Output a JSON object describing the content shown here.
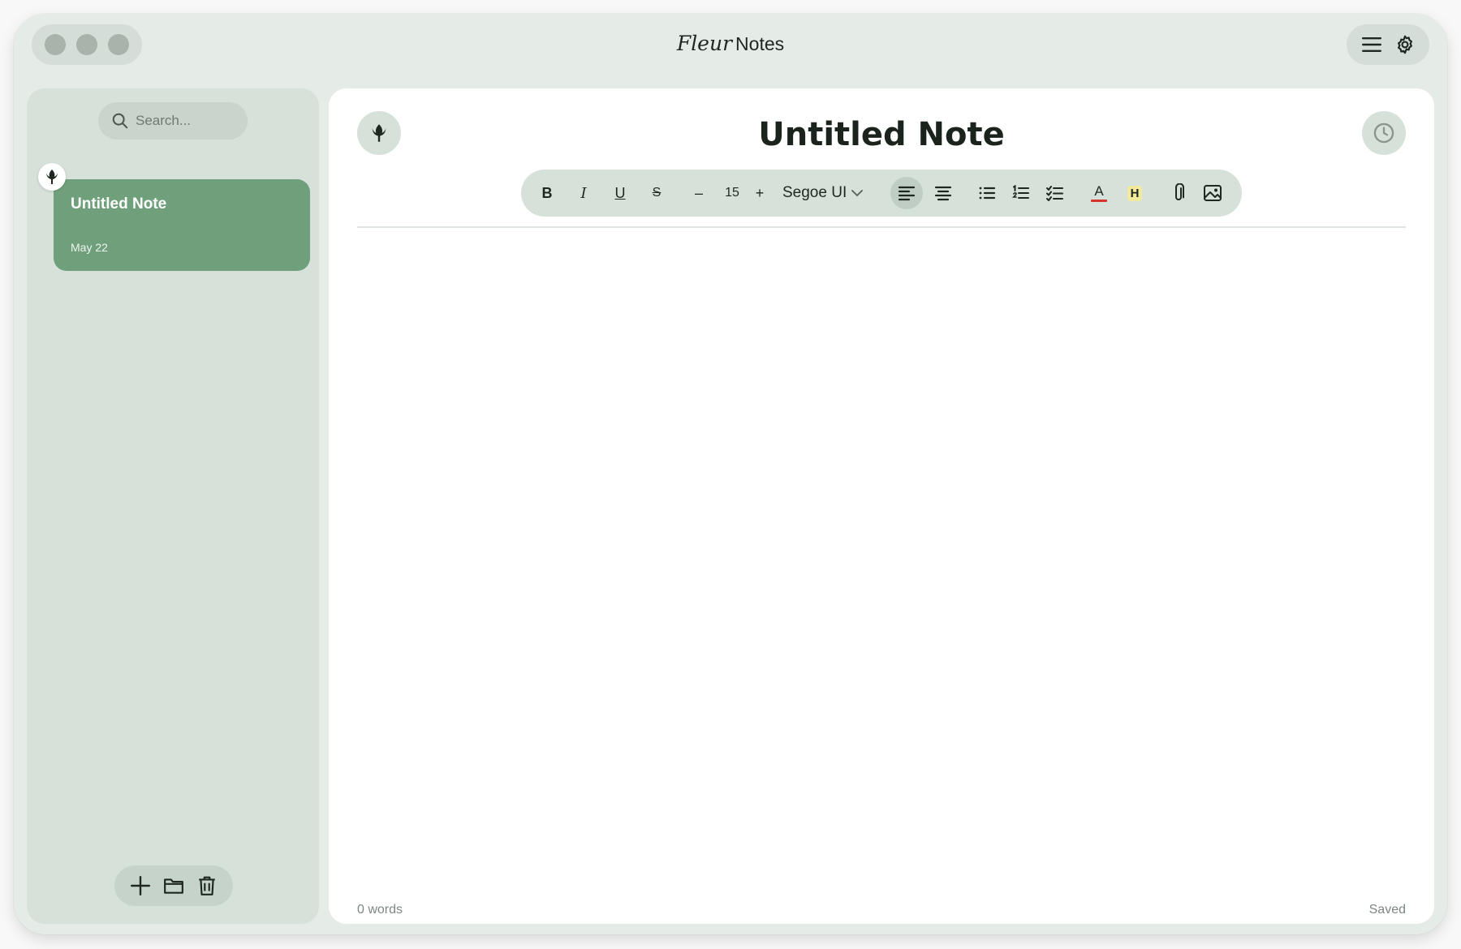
{
  "app": {
    "title_script": "Fleur",
    "title_plain": "Notes"
  },
  "sidebar": {
    "search": {
      "placeholder": "Search..."
    },
    "notes": [
      {
        "title": "Untitled Note",
        "date": "May 22",
        "selected": true
      }
    ]
  },
  "editor": {
    "title": "Untitled Note",
    "toolbar": {
      "bold": "B",
      "italic": "I",
      "underline": "U",
      "strikethrough": "S",
      "decrease": "–",
      "font_size": "15",
      "increase": "+",
      "font_family": "Segoe UI",
      "text_color_label": "A",
      "highlight_label": "H",
      "active_alignment": "left",
      "text_color": "#d9342b",
      "highlight_color": "#f1ea9c"
    },
    "word_count": "0 words",
    "save_status": "Saved"
  },
  "colors": {
    "accent": "#6fa07b",
    "panel": "#d6e1da",
    "window": "#e5ece7"
  },
  "icons": {
    "topbar": [
      "menu-icon",
      "gear-icon"
    ],
    "sidebar_actions": [
      "plus-icon",
      "folder-icon",
      "trash-icon"
    ],
    "editor": [
      "lotus-icon",
      "clock-icon",
      "paperclip-icon",
      "image-icon"
    ]
  }
}
